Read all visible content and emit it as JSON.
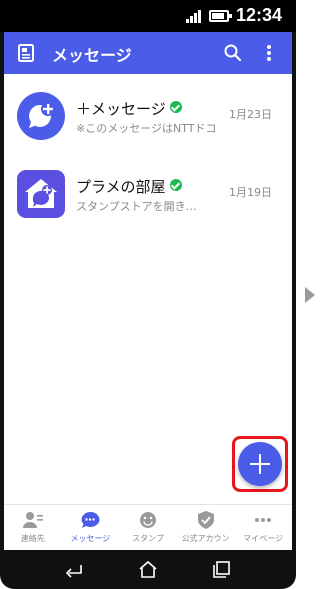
{
  "status_bar": {
    "time": "12:34"
  },
  "app_bar": {
    "title": "メッセージ"
  },
  "messages": [
    {
      "name": "＋メッセージ",
      "preview": "※このメッセージはNTTドコモ",
      "date": "1月23日"
    },
    {
      "name": "プラメの部屋",
      "preview": "スタンプストアを開き…",
      "date": "1月19日"
    }
  ],
  "bottom_nav": [
    {
      "label": "連絡先",
      "icon": "contacts-icon"
    },
    {
      "label": "メッセージ",
      "icon": "chat-bubble-icon",
      "active": true
    },
    {
      "label": "スタンプ",
      "icon": "sticker-smile-icon"
    },
    {
      "label": "公式アカウン",
      "icon": "shield-check-icon"
    },
    {
      "label": "マイページ",
      "icon": "more-dots-icon"
    }
  ],
  "colors": {
    "accent": "#4a5ce8",
    "highlight": "#e8161b",
    "verified": "#1db954"
  }
}
